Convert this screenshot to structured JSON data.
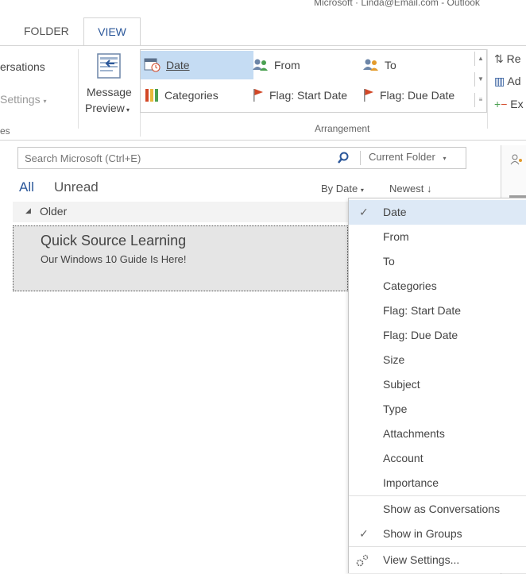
{
  "title_fragment": "Microsoft · Linda@Email.com - Outlook",
  "tabs": {
    "folder": "FOLDER",
    "view": "VIEW"
  },
  "ribbon": {
    "conversations": "ersations",
    "conv_settings": "Settings",
    "group_left_fragment": "es",
    "message_preview": [
      "Message",
      "Preview"
    ],
    "arrangement": {
      "label": "Arrangement",
      "items": [
        "Date",
        "From",
        "To",
        "Categories",
        "Flag: Start Date",
        "Flag: Due Date"
      ]
    },
    "right_cmds": [
      "Re",
      "Ad",
      "Ex"
    ]
  },
  "search": {
    "placeholder": "Search Microsoft (Ctrl+E)",
    "scope": "Current Folder"
  },
  "filters": {
    "all": "All",
    "unread": "Unread",
    "by": "By Date",
    "order": "Newest"
  },
  "list": {
    "group": "Older",
    "items": [
      {
        "sender": "Quick Source Learning",
        "subject": "Our Windows 10 Guide Is Here!"
      }
    ]
  },
  "menu": {
    "items": [
      {
        "label": "Date",
        "checked": true
      },
      {
        "label": "From"
      },
      {
        "label": "To"
      },
      {
        "label": "Categories"
      },
      {
        "label": "Flag: Start Date"
      },
      {
        "label": "Flag: Due Date"
      },
      {
        "label": "Size"
      },
      {
        "label": "Subject"
      },
      {
        "label": "Type"
      },
      {
        "label": "Attachments"
      },
      {
        "label": "Account"
      },
      {
        "label": "Importance"
      }
    ],
    "options": [
      {
        "label": "Show as Conversations"
      },
      {
        "label": "Show in Groups",
        "checked": true
      }
    ],
    "view_settings": "View Settings...",
    "checkmark": "✓"
  },
  "colors": {
    "accent": "#2b579a",
    "selected": "#c5dcf3",
    "flag": "#d24726",
    "item_bg": "#e5e5e5"
  }
}
